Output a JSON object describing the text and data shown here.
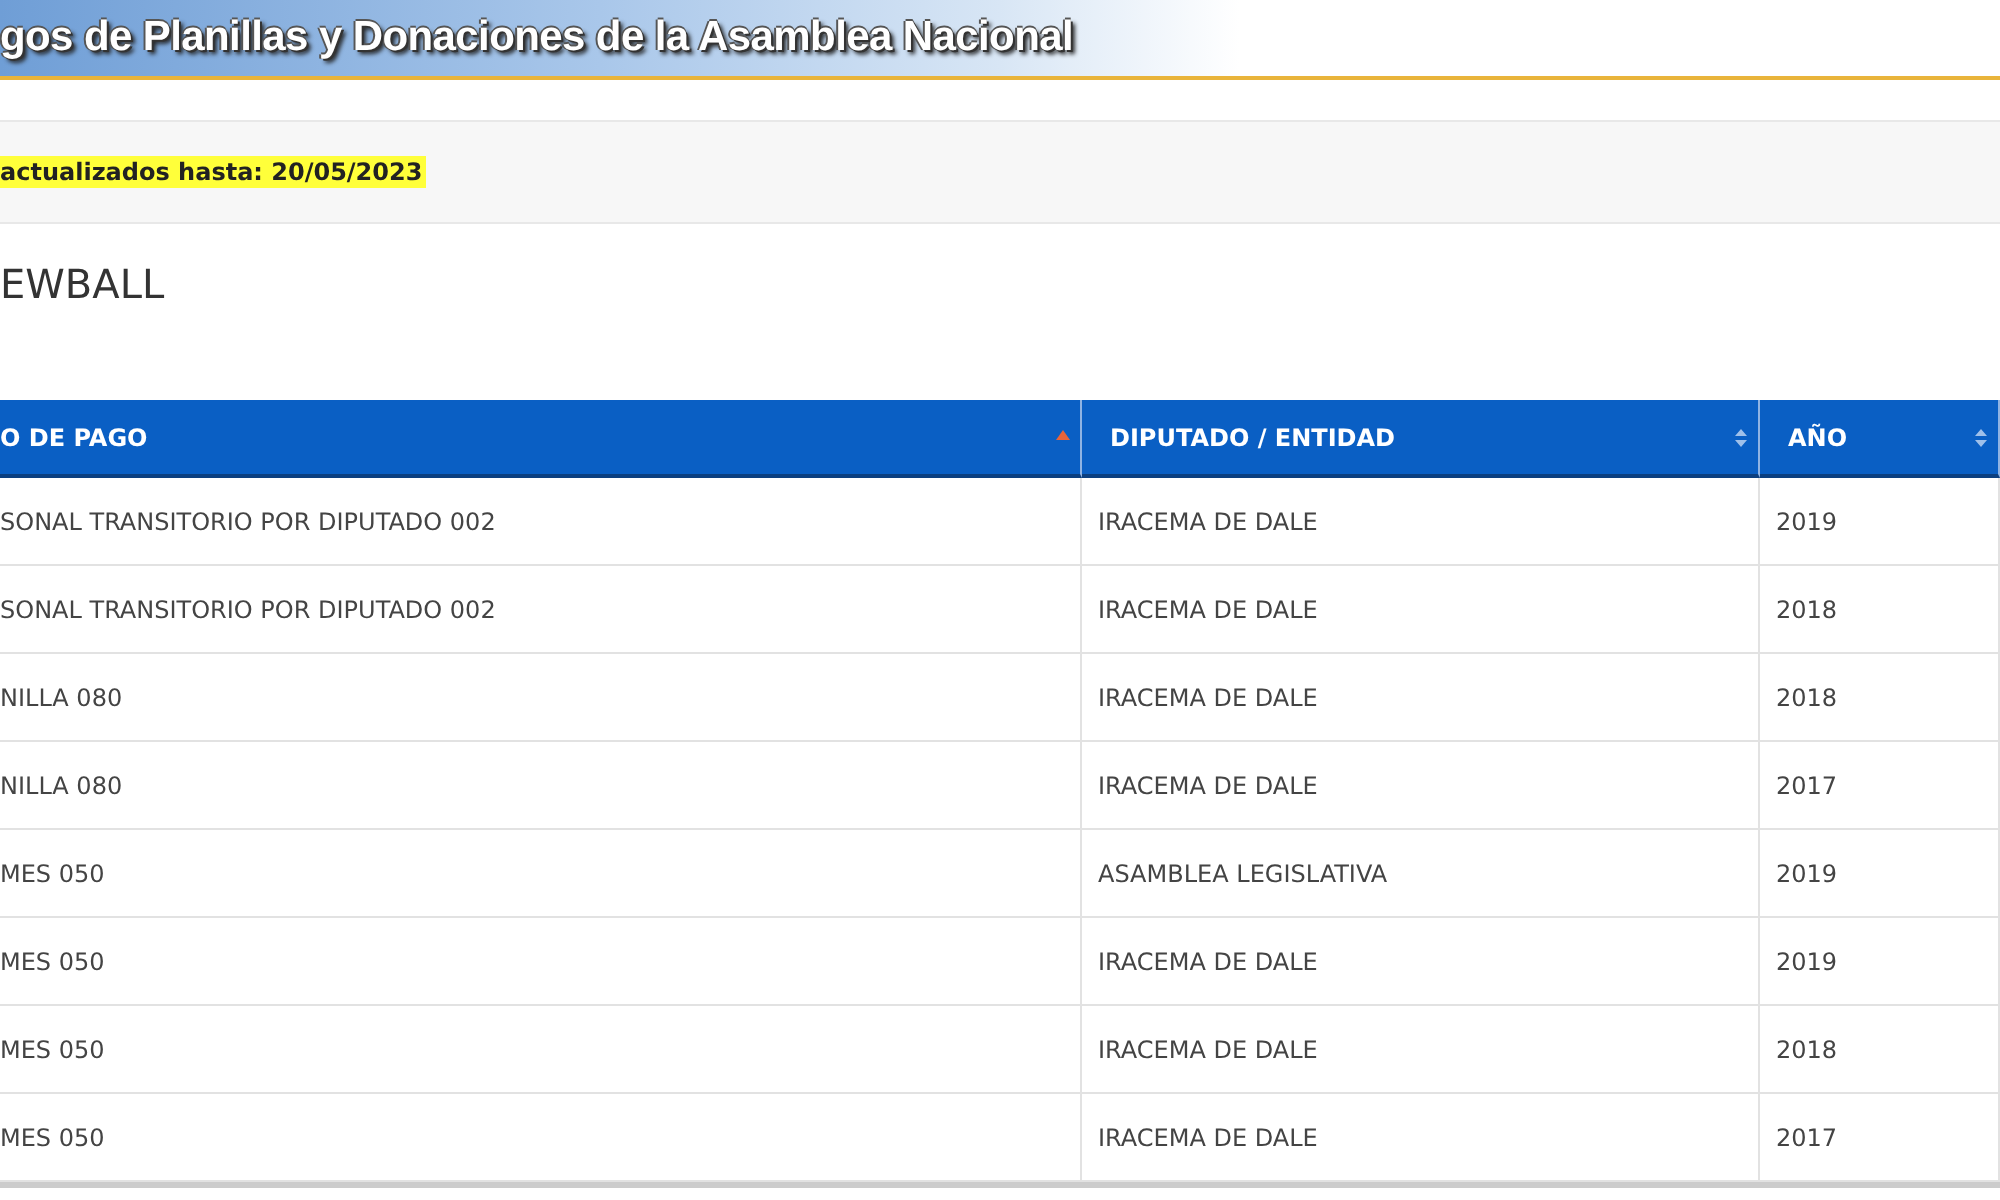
{
  "banner": {
    "title": "gos de Planillas y Donaciones de la Asamblea Nacional"
  },
  "notice": {
    "text": "actualizados hasta: 20/05/2023"
  },
  "heading": "EWBALL",
  "table": {
    "columns": [
      {
        "label": "O DE PAGO",
        "sorted": true
      },
      {
        "label": "DIPUTADO / ENTIDAD",
        "sorted": false
      },
      {
        "label": "AÑO",
        "sorted": false
      }
    ],
    "rows": [
      [
        "SONAL TRANSITORIO POR DIPUTADO 002",
        "IRACEMA DE DALE",
        "2019"
      ],
      [
        "SONAL TRANSITORIO POR DIPUTADO 002",
        "IRACEMA DE DALE",
        "2018"
      ],
      [
        "NILLA 080",
        "IRACEMA DE DALE",
        "2018"
      ],
      [
        "NILLA 080",
        "IRACEMA DE DALE",
        "2017"
      ],
      [
        "MES 050",
        "ASAMBLEA LEGISLATIVA",
        "2019"
      ],
      [
        "MES 050",
        "IRACEMA DE DALE",
        "2019"
      ],
      [
        "MES 050",
        "IRACEMA DE DALE",
        "2018"
      ],
      [
        "MES 050",
        "IRACEMA DE DALE",
        "2017"
      ]
    ]
  }
}
